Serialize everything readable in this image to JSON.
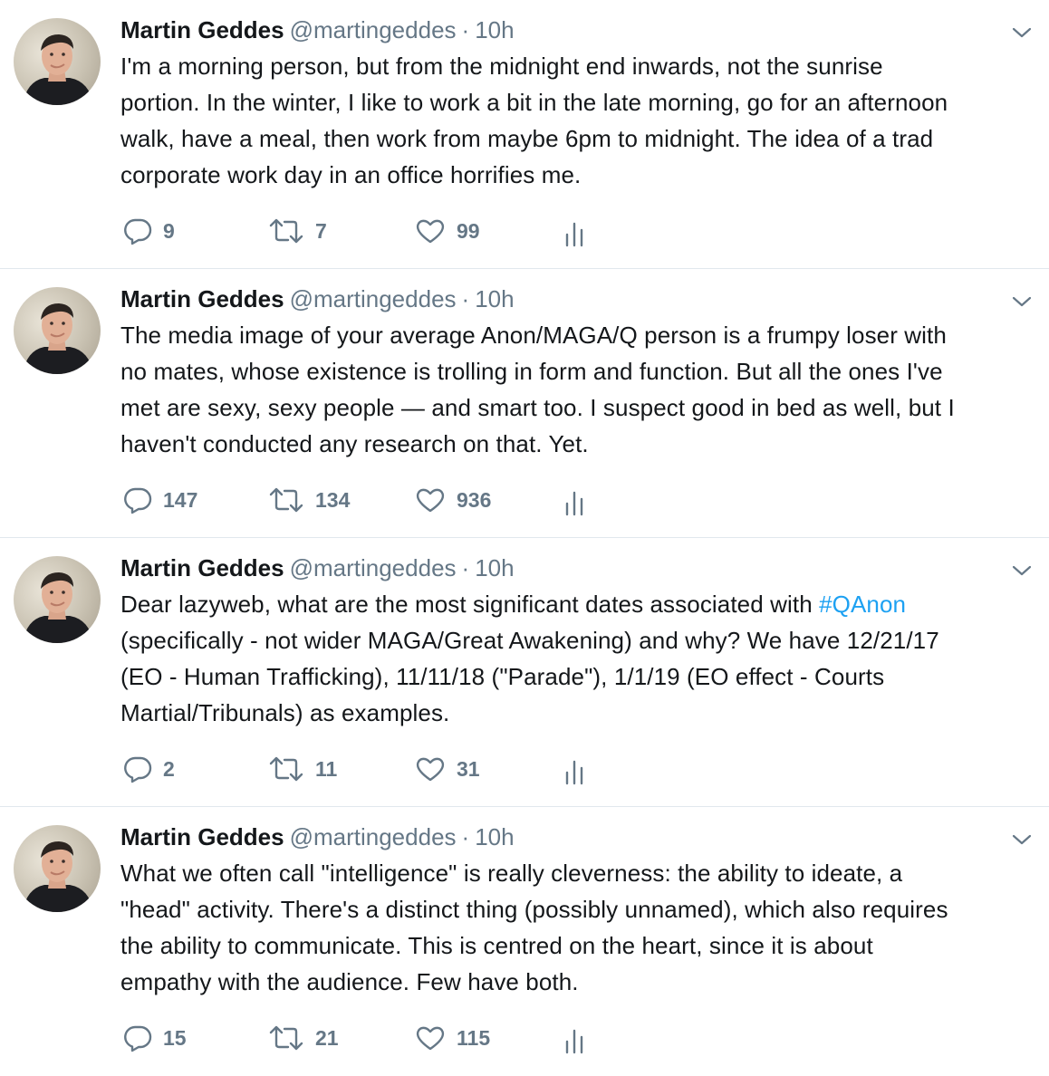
{
  "tweets": [
    {
      "name": "Martin Geddes",
      "handle": "@martingeddes",
      "separator": "·",
      "time": "10h",
      "text_lines": [
        "I'm a morning person, but from the midnight end inwards, not the sunrise",
        "portion. In the winter, I like to work a bit in the late morning, go for an afternoon",
        "walk, have a meal, then work from maybe 6pm to midnight. The idea of a trad",
        "corporate work day in an office horrifies me."
      ],
      "replies": "9",
      "retweets": "7",
      "likes": "99"
    },
    {
      "name": "Martin Geddes",
      "handle": "@martingeddes",
      "separator": "·",
      "time": "10h",
      "text_lines": [
        "The media image of your average Anon/MAGA/Q person is a frumpy loser with",
        "no mates, whose existence is trolling in form and function. But all the ones I've",
        "met are sexy, sexy people — and smart too. I suspect good in bed as well, but I",
        "haven't conducted any research on that. Yet."
      ],
      "replies": "147",
      "retweets": "134",
      "likes": "936"
    },
    {
      "name": "Martin Geddes",
      "handle": "@martingeddes",
      "separator": "·",
      "time": "10h",
      "text_line1_before": "Dear lazyweb, what are the most significant dates associated with ",
      "hashtag": "#QAnon",
      "text_lines_rest": [
        "(specifically - not wider MAGA/Great Awakening) and why? We have 12/21/17",
        "(EO - Human Trafficking), 11/11/18 (\"Parade\"), 1/1/19 (EO effect - Courts",
        "Martial/Tribunals) as examples."
      ],
      "replies": "2",
      "retweets": "11",
      "likes": "31"
    },
    {
      "name": "Martin Geddes",
      "handle": "@martingeddes",
      "separator": "·",
      "time": "10h",
      "text_lines": [
        "What we often call \"intelligence\" is really cleverness: the ability to ideate, a",
        "\"head\" activity. There's a distinct thing (possibly unnamed), which also requires",
        "the ability to communicate. This is centred on the heart, since it is about",
        "empathy with the audience. Few have both."
      ],
      "replies": "15",
      "retweets": "21",
      "likes": "115"
    }
  ],
  "colors": {
    "text": "#14171a",
    "secondary": "#657786",
    "link": "#1da1f2",
    "divider": "#e1e8ed"
  },
  "icons": {
    "reply": "reply-icon",
    "retweet": "retweet-icon",
    "like": "heart-icon",
    "stats": "analytics-icon",
    "caret": "chevron-down-icon"
  }
}
